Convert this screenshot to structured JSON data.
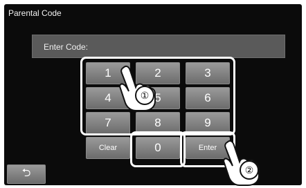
{
  "title": "Parental Code",
  "entry": {
    "label": "Enter Code:"
  },
  "keypad": {
    "row1": [
      "1",
      "2",
      "3"
    ],
    "row2": [
      "4",
      "5",
      "6"
    ],
    "row3": [
      "7",
      "8",
      "9"
    ],
    "clear": "Clear",
    "zero": "0",
    "enter": "Enter",
    "back_icon": "back-arrow-icon"
  },
  "callouts": {
    "one": "①",
    "two": "②"
  }
}
